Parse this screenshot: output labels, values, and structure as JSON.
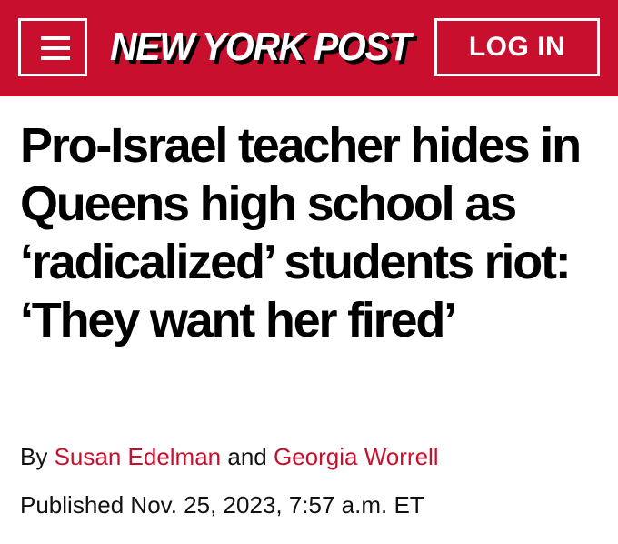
{
  "header": {
    "menu_icon": "hamburger-menu-icon",
    "logo_text": "NEW YORK POST",
    "login_label": "LOG IN",
    "brand_color": "#c8102e"
  },
  "article": {
    "headline": "Pro-Israel teacher hides in Queens high school as ‘radicalized’ students riot: ‘They want her fired’",
    "byline": {
      "prefix": "By",
      "author1": "Susan Edelman",
      "conjunction": "and",
      "author2": "Georgia Worrell"
    },
    "published": "Published Nov. 25, 2023, 7:57 a.m. ET"
  }
}
